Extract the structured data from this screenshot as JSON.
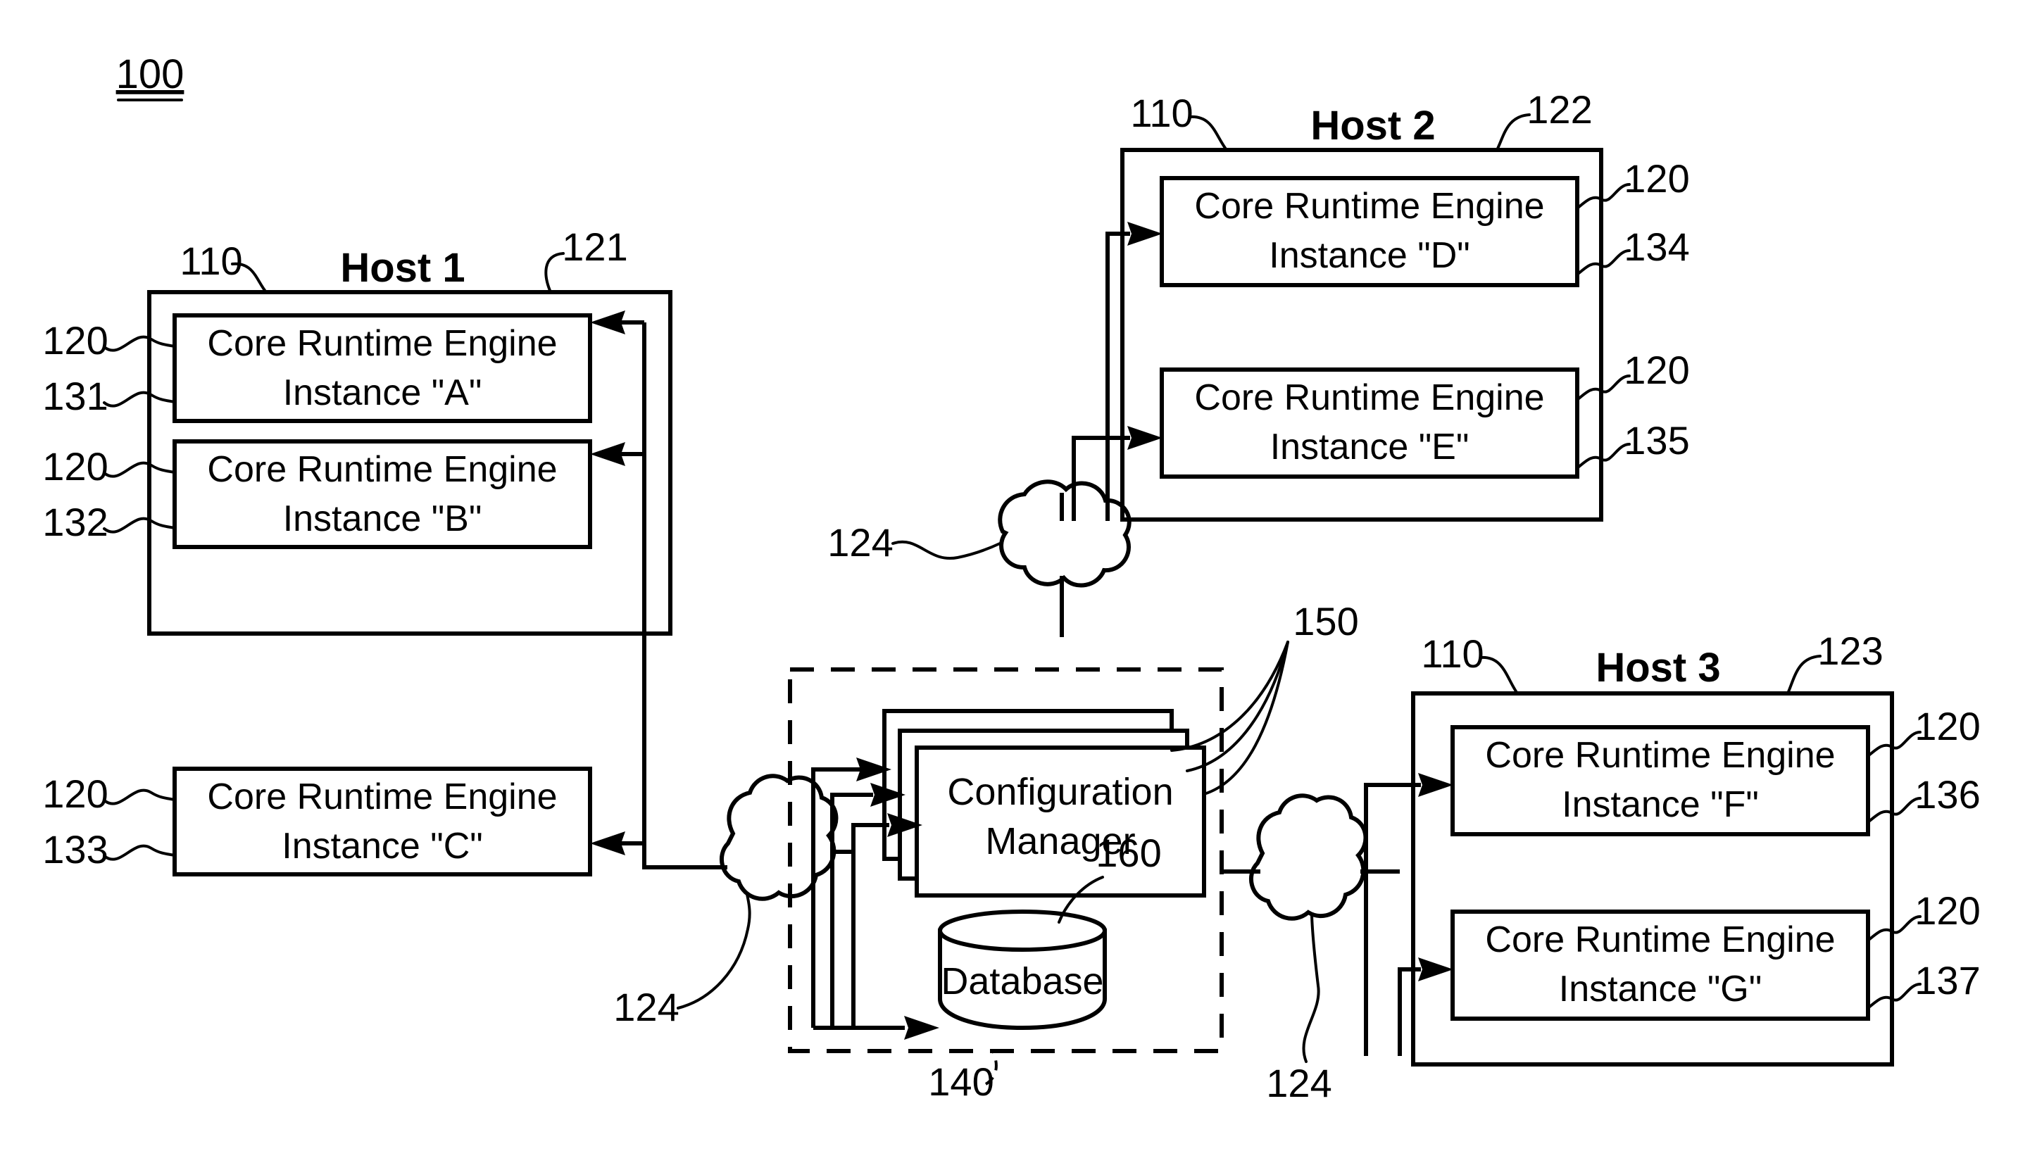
{
  "figure": {
    "number": "100",
    "title_label": "100"
  },
  "hosts": [
    {
      "id": "host-1",
      "title": "Host 1",
      "host_ref": "110",
      "box_ref": "121",
      "engines": [
        {
          "line1": "Core Runtime Engine",
          "line2": "Instance \"A\"",
          "engine_ref": "120",
          "instance_ref": "131"
        },
        {
          "line1": "Core Runtime Engine",
          "line2": "Instance \"B\"",
          "engine_ref": "120",
          "instance_ref": "132"
        },
        {
          "line1": "Core Runtime Engine",
          "line2": "Instance \"C\"",
          "engine_ref": "120",
          "instance_ref": "133"
        }
      ]
    },
    {
      "id": "host-2",
      "title": "Host 2",
      "host_ref": "110",
      "box_ref": "122",
      "engines": [
        {
          "line1": "Core Runtime Engine",
          "line2": "Instance \"D\"",
          "engine_ref": "120",
          "instance_ref": "134"
        },
        {
          "line1": "Core Runtime Engine",
          "line2": "Instance \"E\"",
          "engine_ref": "120",
          "instance_ref": "135"
        }
      ]
    },
    {
      "id": "host-3",
      "title": "Host 3",
      "host_ref": "110",
      "box_ref": "123",
      "engines": [
        {
          "line1": "Core Runtime Engine",
          "line2": "Instance \"F\"",
          "engine_ref": "120",
          "instance_ref": "136"
        },
        {
          "line1": "Core Runtime Engine",
          "line2": "Instance \"G\"",
          "engine_ref": "120",
          "instance_ref": "137"
        }
      ]
    }
  ],
  "management": {
    "container_ref": "140",
    "config_manager": {
      "line1": "Configuration",
      "line2": "Manager",
      "ref": "150"
    },
    "database": {
      "label": "Database",
      "ref": "160"
    }
  },
  "networks": [
    {
      "id": "network-host1",
      "ref": "124"
    },
    {
      "id": "network-host2",
      "ref": "124"
    },
    {
      "id": "network-host3",
      "ref": "124"
    }
  ],
  "icons": {
    "cloud": "cloud-icon",
    "database_cylinder": "database-cylinder-icon",
    "arrow": "arrow-icon"
  }
}
